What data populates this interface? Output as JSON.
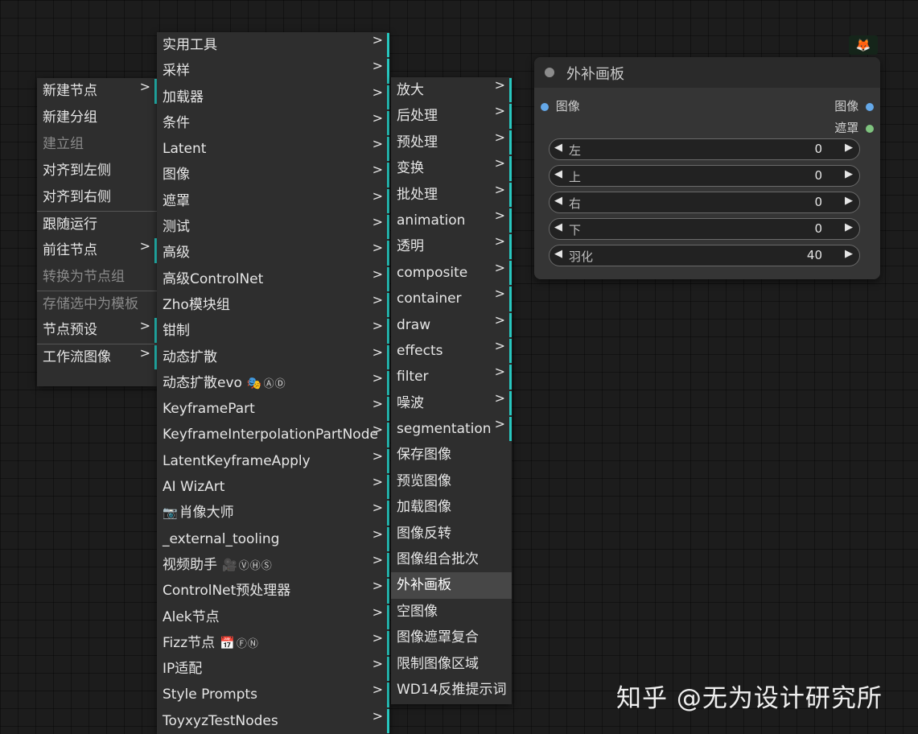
{
  "context_menu": {
    "items": [
      {
        "label": "新建节点",
        "submenu": true
      },
      {
        "label": "新建分组"
      },
      {
        "label": "建立组",
        "disabled": true
      },
      {
        "label": "对齐到左侧"
      },
      {
        "label": "对齐到右侧"
      },
      {
        "label": "跟随运行",
        "separator": true
      },
      {
        "label": "前往节点",
        "submenu": true
      },
      {
        "label": "转换为节点组",
        "disabled": true
      },
      {
        "label": "存储选中为模板",
        "disabled": true,
        "separator": true
      },
      {
        "label": "节点预设",
        "submenu": true
      },
      {
        "label": "工作流图像",
        "submenu": true,
        "separator": true
      }
    ]
  },
  "category_menu": {
    "items": [
      {
        "label": "实用工具"
      },
      {
        "label": "采样"
      },
      {
        "label": "加载器"
      },
      {
        "label": "条件"
      },
      {
        "label": "Latent"
      },
      {
        "label": "图像"
      },
      {
        "label": "遮罩"
      },
      {
        "label": "测试"
      },
      {
        "label": "高级"
      },
      {
        "label": "高级ControlNet"
      },
      {
        "label": "Zho模块组"
      },
      {
        "label": "钳制"
      },
      {
        "label": "动态扩散"
      },
      {
        "label": "动态扩散evo",
        "badge_emoji": "🎭",
        "badge_circles": "ⒶⒹ"
      },
      {
        "label": "KeyframePart"
      },
      {
        "label": "KeyframeInterpolationPartNode"
      },
      {
        "label": "LatentKeyframeApply"
      },
      {
        "label": "AI WizArt"
      },
      {
        "label": "肖像大师",
        "lead_emoji": "📷"
      },
      {
        "label": "_external_tooling"
      },
      {
        "label": "视频助手",
        "badge_emoji": "🎥",
        "badge_circles": "ⓋⒽⓈ"
      },
      {
        "label": "ControlNet预处理器"
      },
      {
        "label": "Alek节点"
      },
      {
        "label": "Fizz节点",
        "badge_emoji": "📅",
        "badge_circles": "ⒻⓃ"
      },
      {
        "label": "IP适配"
      },
      {
        "label": "Style Prompts"
      },
      {
        "label": "ToyxyzTestNodes"
      }
    ]
  },
  "image_menu": {
    "items": [
      {
        "label": "放大",
        "submenu": true
      },
      {
        "label": "后处理",
        "submenu": true
      },
      {
        "label": "预处理",
        "submenu": true
      },
      {
        "label": "变换",
        "submenu": true
      },
      {
        "label": "批处理",
        "submenu": true
      },
      {
        "label": "animation",
        "submenu": true
      },
      {
        "label": "透明",
        "submenu": true
      },
      {
        "label": "composite",
        "submenu": true
      },
      {
        "label": "container",
        "submenu": true
      },
      {
        "label": "draw",
        "submenu": true
      },
      {
        "label": "effects",
        "submenu": true
      },
      {
        "label": "filter",
        "submenu": true
      },
      {
        "label": "噪波",
        "submenu": true
      },
      {
        "label": "segmentation",
        "submenu": true
      },
      {
        "label": "保存图像"
      },
      {
        "label": "预览图像"
      },
      {
        "label": "加载图像"
      },
      {
        "label": "图像反转"
      },
      {
        "label": "图像组合批次"
      },
      {
        "label": "外补画板",
        "highlighted": true
      },
      {
        "label": "空图像"
      },
      {
        "label": "图像遮罩复合"
      },
      {
        "label": "限制图像区域"
      },
      {
        "label": "WD14反推提示词"
      }
    ]
  },
  "arrow_glyph": ">",
  "node": {
    "title": "外补画板",
    "input_image_label": "图像",
    "output_image_label": "图像",
    "output_mask_label": "遮罩",
    "widgets": [
      {
        "label": "左",
        "value": "0"
      },
      {
        "label": "上",
        "value": "0"
      },
      {
        "label": "右",
        "value": "0"
      },
      {
        "label": "下",
        "value": "0"
      },
      {
        "label": "羽化",
        "value": "40"
      }
    ],
    "arrow_left": "◀",
    "arrow_right": "▶"
  },
  "top_badge_emoji": "🦊",
  "watermark": "知乎 @无为设计研究所",
  "colors": {
    "accent_bar": "#28c8c0",
    "image_pin": "#64a8e8",
    "mask_pin": "#7fc47f"
  }
}
